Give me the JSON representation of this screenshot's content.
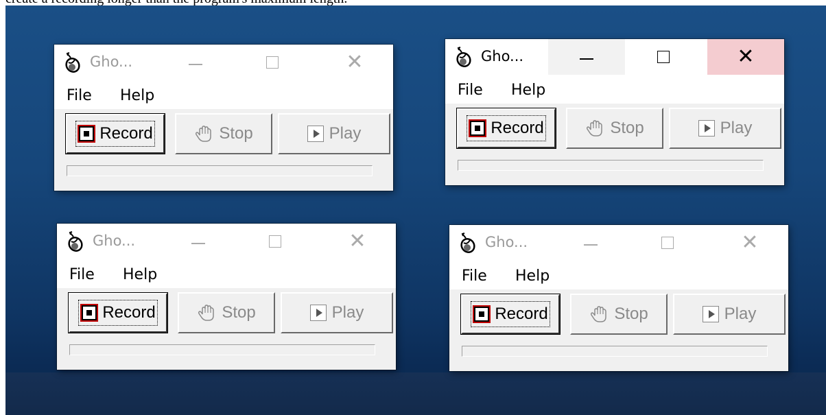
{
  "doc_text": "create a recording longer than the program's maximum length.",
  "app": {
    "title": "Gho...",
    "menu": [
      "File",
      "Help"
    ],
    "buttons": {
      "record": "Record",
      "stop": "Stop",
      "play": "Play"
    },
    "progress": 0
  },
  "colors": {
    "desktop": "#16467a",
    "close_hover": "#f4ccd0",
    "record_border": "#c00000"
  },
  "windows": [
    {
      "id": "top-left",
      "active": false
    },
    {
      "id": "top-right",
      "active": true
    },
    {
      "id": "bottom-left",
      "active": false
    },
    {
      "id": "bottom-right",
      "active": false
    }
  ]
}
